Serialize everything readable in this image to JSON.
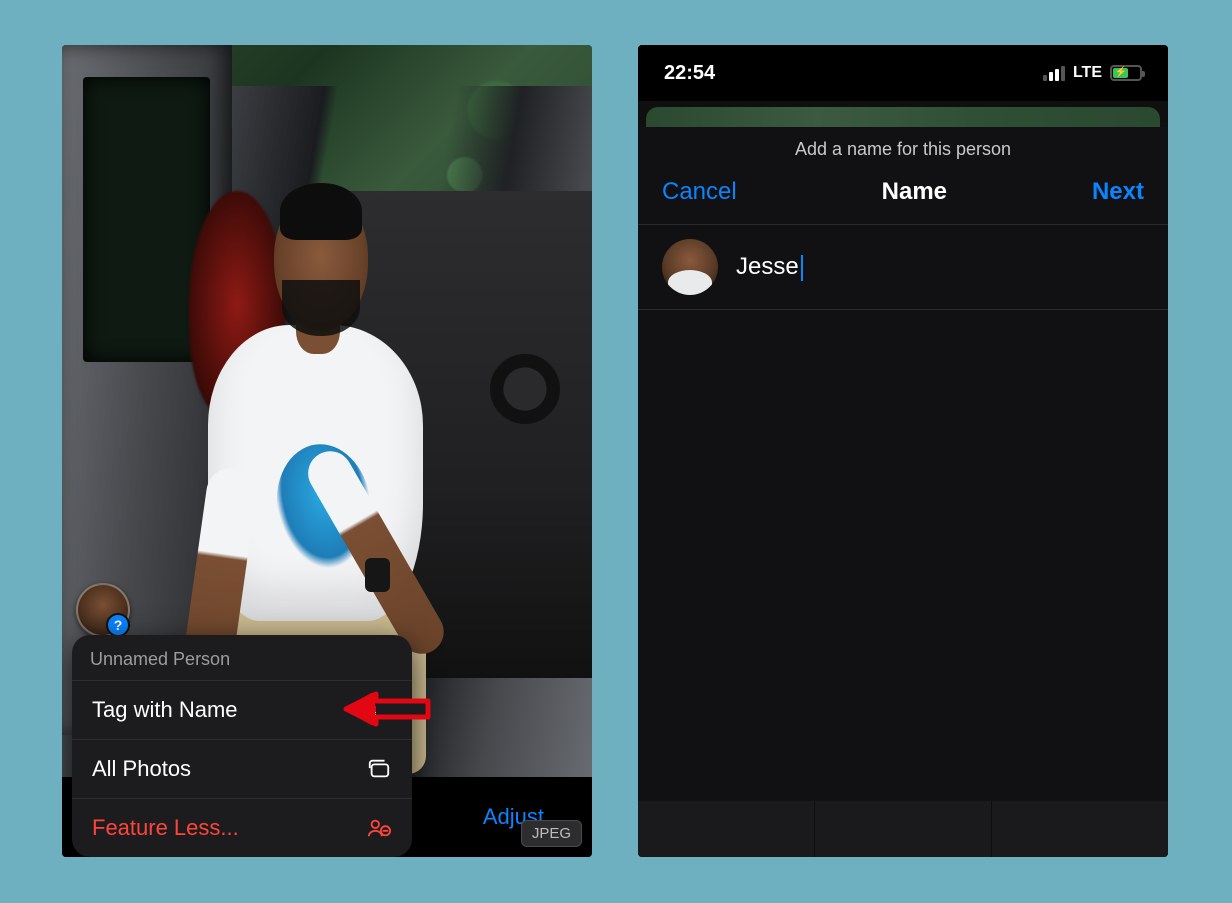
{
  "left": {
    "menu_title": "Unnamed Person",
    "items": {
      "tag": "Tag with Name",
      "all": "All Photos",
      "less": "Feature Less..."
    },
    "toolbar": {
      "adjust": "Adjust",
      "badge": "JPEG"
    }
  },
  "right": {
    "status": {
      "time": "22:54",
      "network": "LTE"
    },
    "sheet": {
      "subtitle": "Add a name for this person",
      "cancel": "Cancel",
      "title": "Name",
      "next": "Next"
    },
    "input": {
      "value": "Jesse"
    }
  }
}
